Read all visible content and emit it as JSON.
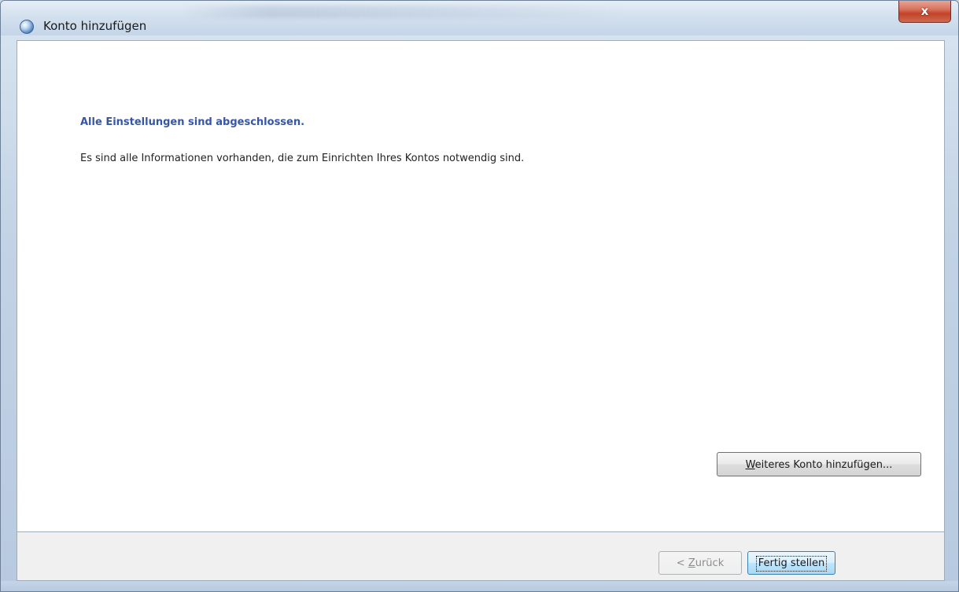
{
  "window": {
    "title": "Konto hinzufügen",
    "close_label": "x"
  },
  "content": {
    "heading": "Alle Einstellungen sind abgeschlossen.",
    "info": "Es sind alle Informationen vorhanden, die zum Einrichten Ihres Kontos notwendig sind.",
    "add_account": {
      "mnemonic": "W",
      "rest": "eiteres Konto hinzufügen..."
    }
  },
  "footer": {
    "back": {
      "prefix": "< ",
      "mnemonic": "Z",
      "rest": "urück",
      "enabled": false
    },
    "finish_label": "Fertig stellen"
  },
  "colors": {
    "heading": "#3656a8",
    "close_button": "#c1432a",
    "footer_background": "#f0f0f0"
  },
  "icons": {
    "app": "outlook-globe-icon",
    "close": "close-icon"
  }
}
